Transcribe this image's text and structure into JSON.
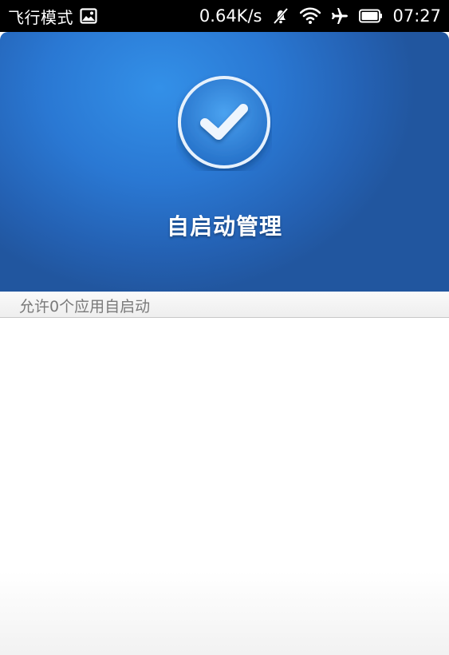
{
  "status_bar": {
    "mode_label": "飞行模式",
    "speed": "0.64K/s",
    "time": "07:27",
    "icons": [
      "image-icon",
      "mute-icon",
      "wifi-icon",
      "airplane-icon",
      "battery-icon"
    ]
  },
  "header": {
    "title": "自启动管理",
    "badge_icon": "checkmark-icon",
    "accent_color": "#2a78d3"
  },
  "subheader": {
    "summary": "允许0个应用自启动"
  },
  "list": {
    "items": []
  }
}
